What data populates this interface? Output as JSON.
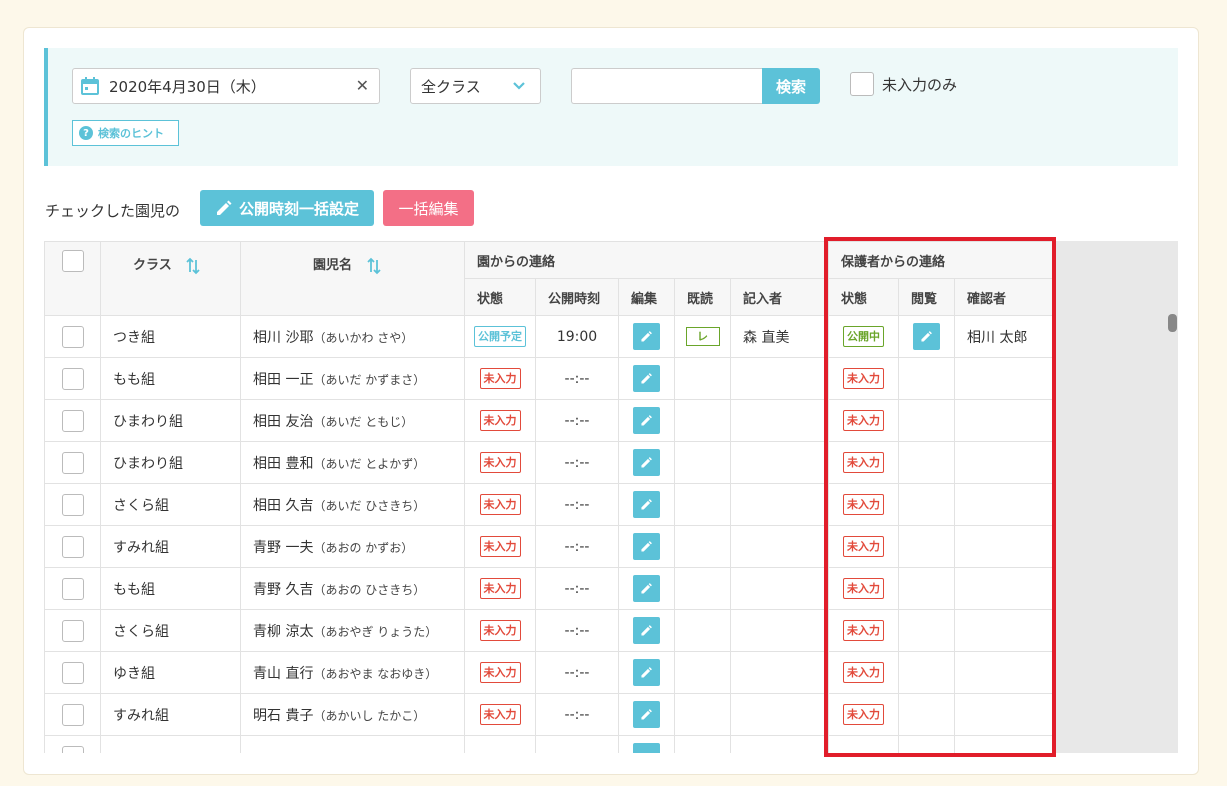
{
  "search": {
    "date_value": "2020年4月30日（木）",
    "class_value": "全クラス",
    "keyword_value": "",
    "keyword_placeholder": "",
    "search_label": "検索",
    "only_empty_label": "未入力のみ",
    "hint_label": "検索のヒント"
  },
  "bulk": {
    "label": "チェックした園児の",
    "time_button": "公開時刻一括設定",
    "edit_button": "一括編集"
  },
  "table": {
    "headers": {
      "class": "クラス",
      "child": "園児名",
      "from_school": "園からの連絡",
      "status": "状態",
      "publish_time": "公開時刻",
      "edit": "編集",
      "read": "既読",
      "author": "記入者",
      "from_parent": "保護者からの連絡",
      "p_status": "状態",
      "view": "閲覧",
      "confirmer": "確認者"
    },
    "rows": [
      {
        "class": "つき組",
        "name": "相川 沙耶",
        "kana": "（あいかわ さや）",
        "status": "公開予定",
        "time": "19:00",
        "read": "レ",
        "author": "森 直美",
        "p_status": "公開中",
        "confirmer": "相川 太郎"
      },
      {
        "class": "もも組",
        "name": "相田 一正",
        "kana": "（あいだ かずまさ）",
        "status": "未入力",
        "time": "--:--",
        "read": "",
        "author": "",
        "p_status": "未入力",
        "confirmer": ""
      },
      {
        "class": "ひまわり組",
        "name": "相田 友治",
        "kana": "（あいだ ともじ）",
        "status": "未入力",
        "time": "--:--",
        "read": "",
        "author": "",
        "p_status": "未入力",
        "confirmer": ""
      },
      {
        "class": "ひまわり組",
        "name": "相田 豊和",
        "kana": "（あいだ とよかず）",
        "status": "未入力",
        "time": "--:--",
        "read": "",
        "author": "",
        "p_status": "未入力",
        "confirmer": ""
      },
      {
        "class": "さくら組",
        "name": "相田 久吉",
        "kana": "（あいだ ひさきち）",
        "status": "未入力",
        "time": "--:--",
        "read": "",
        "author": "",
        "p_status": "未入力",
        "confirmer": ""
      },
      {
        "class": "すみれ組",
        "name": "青野 一夫",
        "kana": "（あおの かずお）",
        "status": "未入力",
        "time": "--:--",
        "read": "",
        "author": "",
        "p_status": "未入力",
        "confirmer": ""
      },
      {
        "class": "もも組",
        "name": "青野 久吉",
        "kana": "（あおの ひさきち）",
        "status": "未入力",
        "time": "--:--",
        "read": "",
        "author": "",
        "p_status": "未入力",
        "confirmer": ""
      },
      {
        "class": "さくら組",
        "name": "青柳 涼太",
        "kana": "（あおやぎ りょうた）",
        "status": "未入力",
        "time": "--:--",
        "read": "",
        "author": "",
        "p_status": "未入力",
        "confirmer": ""
      },
      {
        "class": "ゆき組",
        "name": "青山 直行",
        "kana": "（あおやま なおゆき）",
        "status": "未入力",
        "time": "--:--",
        "read": "",
        "author": "",
        "p_status": "未入力",
        "confirmer": ""
      },
      {
        "class": "すみれ組",
        "name": "明石 貴子",
        "kana": "（あかいし たかこ）",
        "status": "未入力",
        "time": "--:--",
        "read": "",
        "author": "",
        "p_status": "未入力",
        "confirmer": ""
      }
    ]
  },
  "colors": {
    "accent": "#5cc2d8",
    "pink": "#f36f86",
    "red_badge": "#e24a3b",
    "green_badge": "#6aa52a",
    "highlight": "#e11d2a"
  }
}
